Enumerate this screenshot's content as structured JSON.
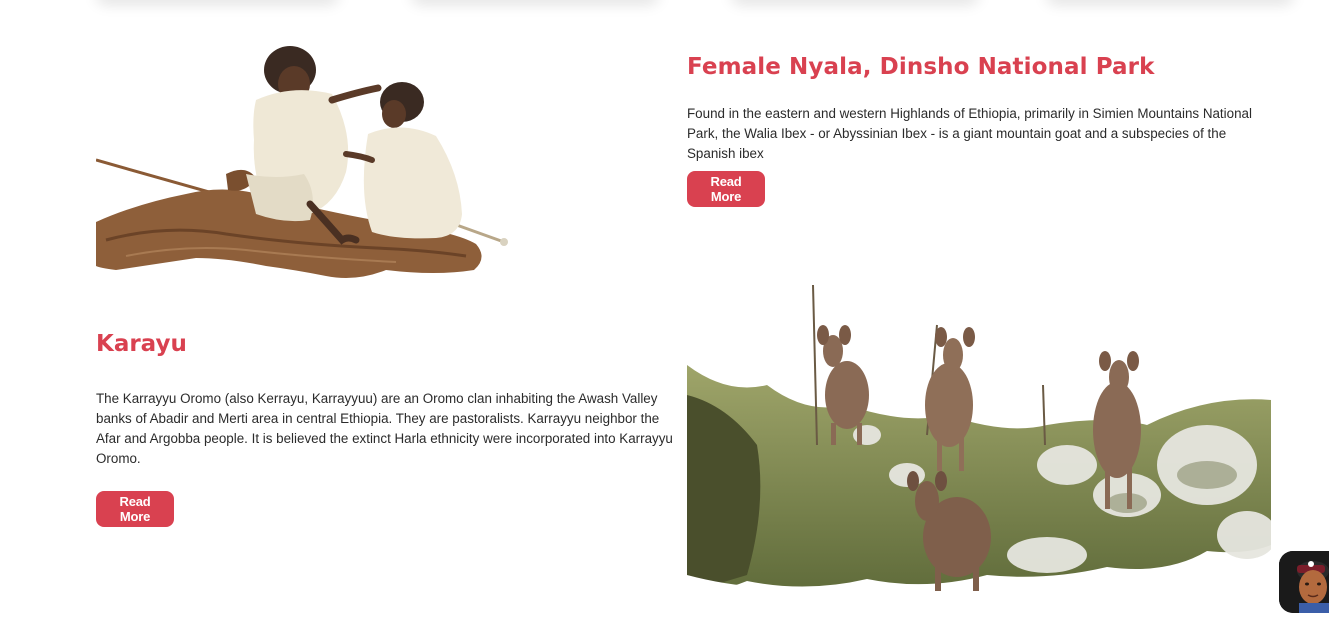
{
  "sections": {
    "nyala": {
      "title": "Female Nyala, Dinsho National Park",
      "description": "Found in the eastern and western Highlands of Ethiopia, primarily in Simien Mountains National Park, the Walia Ibex - or Abyssinian Ibex - is a giant mountain goat and a subspecies of the Spanish ibex",
      "button_label": "Read More",
      "image_alt": "Female nyala standing among highland shrubs"
    },
    "karayu": {
      "title": "Karayu",
      "description": "The Karrayyu Oromo (also Kerrayu, Karrayyuu) are an Oromo clan inhabiting the Awash Valley banks of Abadir and Merti area in central Ethiopia. They are pastoralists. Karrayyu neighbor the Afar and Argobba people. It is believed the extinct Harla ethnicity were incorporated into Karrayyu Oromo.",
      "button_label": "Read More",
      "image_alt": "Two Karayu people sitting on a fallen log"
    }
  },
  "colors": {
    "accent": "#d94150",
    "text": "#2b2b2b",
    "background": "#ffffff"
  },
  "icons": {
    "chat_widget": "avatar-chat-icon"
  }
}
